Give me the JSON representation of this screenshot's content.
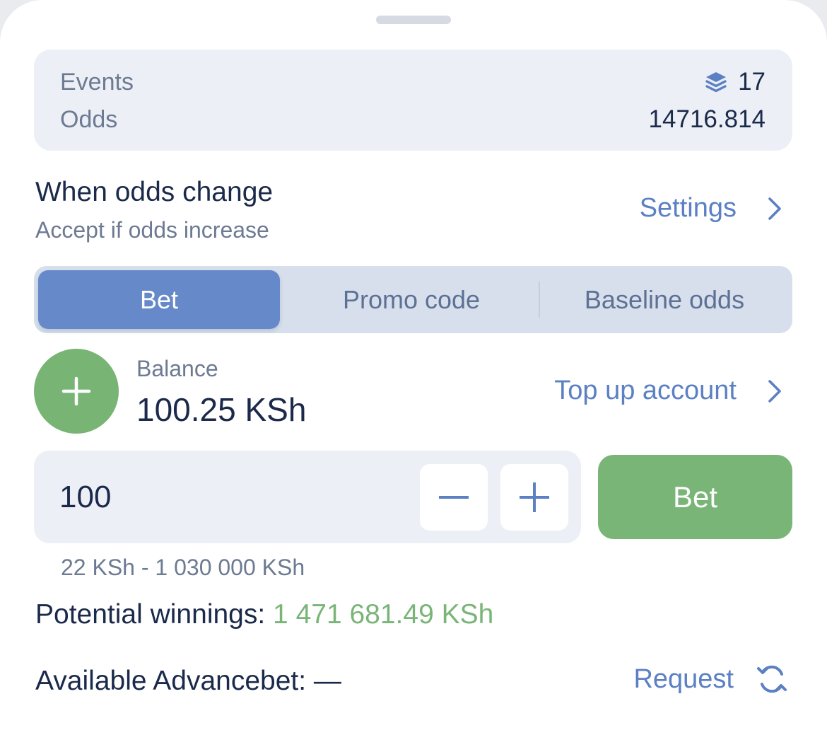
{
  "summary": {
    "events_label": "Events",
    "events_count": "17",
    "odds_label": "Odds",
    "odds_value": "14716.814"
  },
  "odds_change": {
    "title": "When odds change",
    "subtitle": "Accept if odds increase",
    "settings_label": "Settings"
  },
  "tabs": [
    {
      "label": "Bet",
      "active": true
    },
    {
      "label": "Promo code",
      "active": false
    },
    {
      "label": "Baseline odds",
      "active": false
    }
  ],
  "balance": {
    "label": "Balance",
    "value": "100.25 KSh",
    "top_up_label": "Top up account"
  },
  "stake": {
    "value": "100",
    "range": "22 KSh - 1 030 000 KSh",
    "bet_label": "Bet"
  },
  "potential": {
    "label": "Potential winnings:",
    "value": "1 471 681.49 KSh"
  },
  "advancebet": {
    "label": "Available Advancebet: —",
    "request_label": "Request"
  },
  "colors": {
    "accent_blue": "#5b80c3",
    "active_tab": "#6689c9",
    "green": "#7ab578",
    "text_dark": "#1b2a4a",
    "text_muted": "#6c7a92"
  },
  "icons": [
    "stack-layers-icon",
    "chevron-right-icon",
    "plus-icon",
    "minus-icon",
    "refresh-icon"
  ]
}
